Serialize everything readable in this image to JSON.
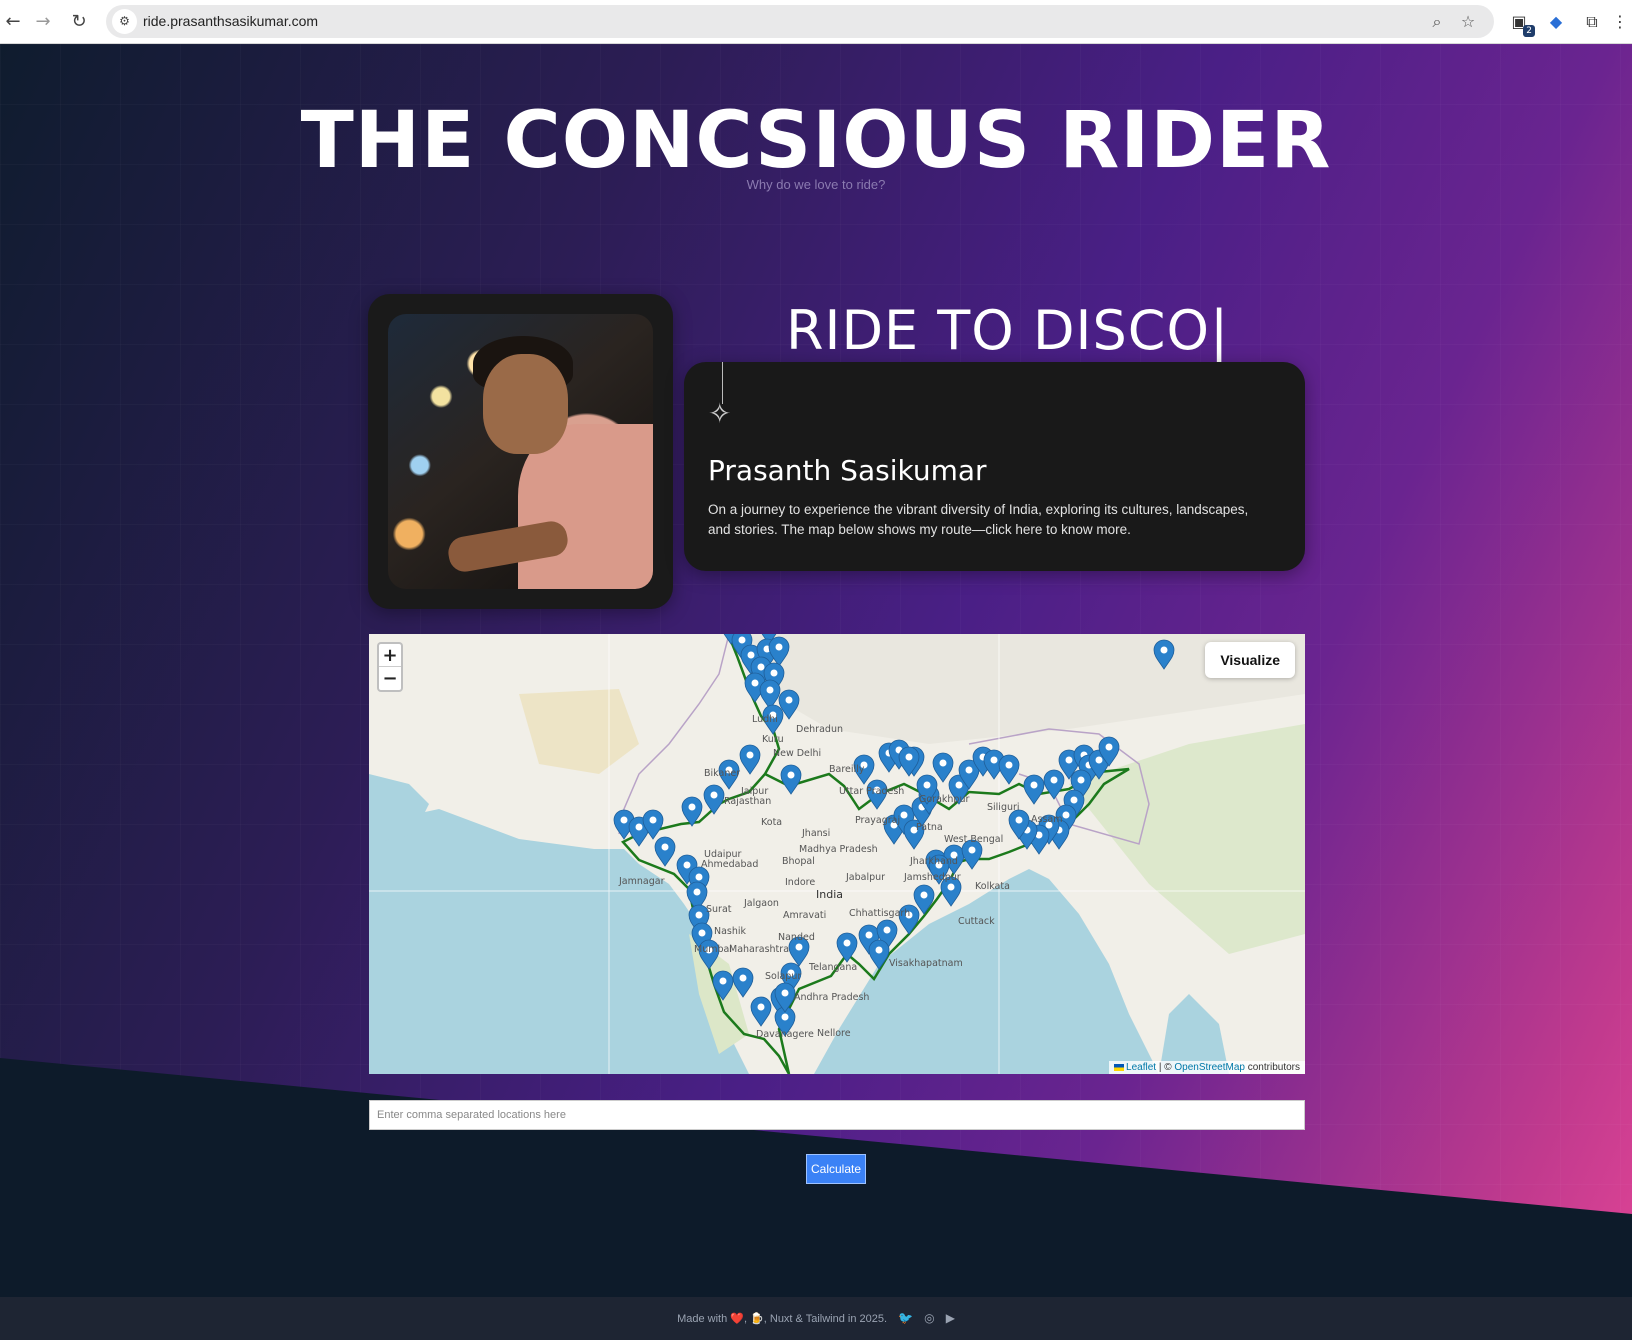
{
  "browser": {
    "url": "ride.prasanthsasikumar.com",
    "back_icon": "arrow-left-icon",
    "forward_icon": "arrow-right-icon",
    "reload_icon": "reload-icon",
    "extension_badge": "2"
  },
  "header": {
    "title": "THE CONCSIOUS RIDER",
    "subtitle": "Why do we love to ride?"
  },
  "hero": {
    "typed_text": "RIDE TO DISCO|"
  },
  "bio": {
    "name": "Prasanth Sasikumar",
    "text": "On a journey to experience the vibrant diversity of India, exploring its cultures, landscapes, and stories. The map below shows my route—click here to know more."
  },
  "map": {
    "zoom_in": "+",
    "zoom_out": "−",
    "visualize_label": "Visualize",
    "attribution_leaflet": "Leaflet",
    "attribution_sep": " | © ",
    "attribution_osm": "OpenStreetMap",
    "attribution_tail": " contributors",
    "route_color": "#1c7a1c",
    "marker_color": "#2a81cb",
    "sea_color": "#aad3df",
    "land_color": "#f1efe8",
    "labels": [
      "Ludhi",
      "Dehradun",
      "New Delhi",
      "Kuru",
      "Bikaner",
      "Jaipur",
      "Kota",
      "Bareilly",
      "Gorakhpur",
      "Udaipur",
      "Ahmedabad",
      "Bhopal",
      "Indore",
      "Jhansi",
      "Prayagraj",
      "Patna",
      "Jamnagar",
      "Jabalpur",
      "Jamshedpur",
      "Kolkata",
      "Madhya Pradesh",
      "Uttar Pradesh",
      "West Bengal",
      "Jharkhand",
      "Rajasthan",
      "Surat",
      "Jalgaon",
      "Amravati",
      "India",
      "Chhattisgarh",
      "Cuttack",
      "Nashik",
      "Nanded",
      "Mumbai",
      "Maharashtra",
      "Visakhapatnam",
      "Solapur",
      "Telangana",
      "Andhra Pradesh",
      "Davanagere",
      "Nellore",
      "Siliguri",
      "Assam"
    ]
  },
  "calculator": {
    "placeholder": "Enter comma separated locations here",
    "button_label": "Calculate"
  },
  "footer": {
    "text": "Made with ❤️, 🍺, Nuxt & Tailwind in 2025.",
    "social": [
      "twitter-icon",
      "instagram-icon",
      "youtube-icon"
    ]
  }
}
